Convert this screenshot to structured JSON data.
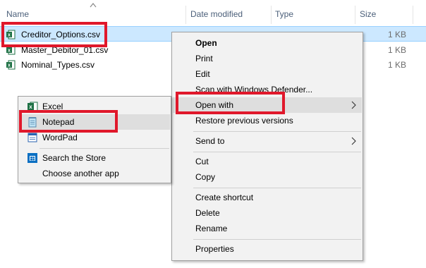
{
  "columns": {
    "name": "Name",
    "date_modified": "Date modified",
    "type": "Type",
    "size": "Size"
  },
  "files": [
    {
      "name": "Creditor_Options.csv",
      "size": "1 KB",
      "icon": "excel-csv-icon"
    },
    {
      "name": "Master_Debitor_01.csv",
      "size": "1 KB",
      "icon": "excel-csv-icon"
    },
    {
      "name": "Nominal_Types.csv",
      "size": "1 KB",
      "icon": "excel-csv-icon"
    }
  ],
  "context_menu": {
    "open": "Open",
    "print": "Print",
    "edit": "Edit",
    "scan": "Scan with Windows Defender...",
    "open_with": "Open with",
    "restore": "Restore previous versions",
    "send_to": "Send to",
    "cut": "Cut",
    "copy": "Copy",
    "create_shortcut": "Create shortcut",
    "delete": "Delete",
    "rename": "Rename",
    "properties": "Properties"
  },
  "open_with_menu": {
    "excel": "Excel",
    "notepad": "Notepad",
    "wordpad": "WordPad",
    "store": "Search the Store",
    "choose": "Choose another app"
  },
  "colors": {
    "highlight": "#e0182b",
    "selection": "#cce8ff",
    "excel_green": "#1e7145"
  }
}
